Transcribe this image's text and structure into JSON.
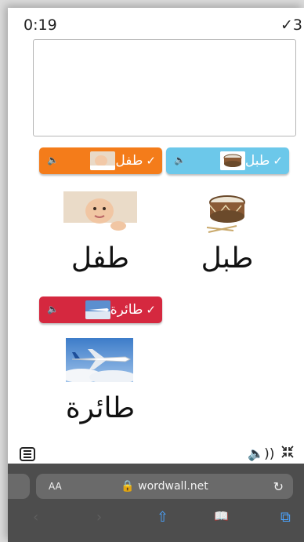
{
  "game": {
    "timer": "0:19",
    "score": "✓3"
  },
  "chips": {
    "baby": {
      "label": "طفل",
      "check": "✓",
      "speaker": "🔈"
    },
    "drum": {
      "label": "طبل",
      "check": "✓",
      "speaker": "🔈"
    },
    "plane": {
      "label": "طائرة",
      "check": "✓",
      "speaker": "🔈"
    }
  },
  "words": {
    "baby": "طفل",
    "drum": "طبل",
    "plane": "طائرة"
  },
  "toolbar": {
    "menu_icon": "menu-icon",
    "sound_icon": "🔈))",
    "fullscreen_icon": "collapse-icon"
  },
  "browser": {
    "aa": "AA",
    "url": "🔒 wordwall.net",
    "reload": "↻",
    "back": "‹",
    "forward": "›",
    "share": "⇧",
    "bookmarks": "📖",
    "tabs": "⧉"
  },
  "colors": {
    "orange": "#f47c1a",
    "blue": "#6cc8ea",
    "red": "#d5283f"
  }
}
